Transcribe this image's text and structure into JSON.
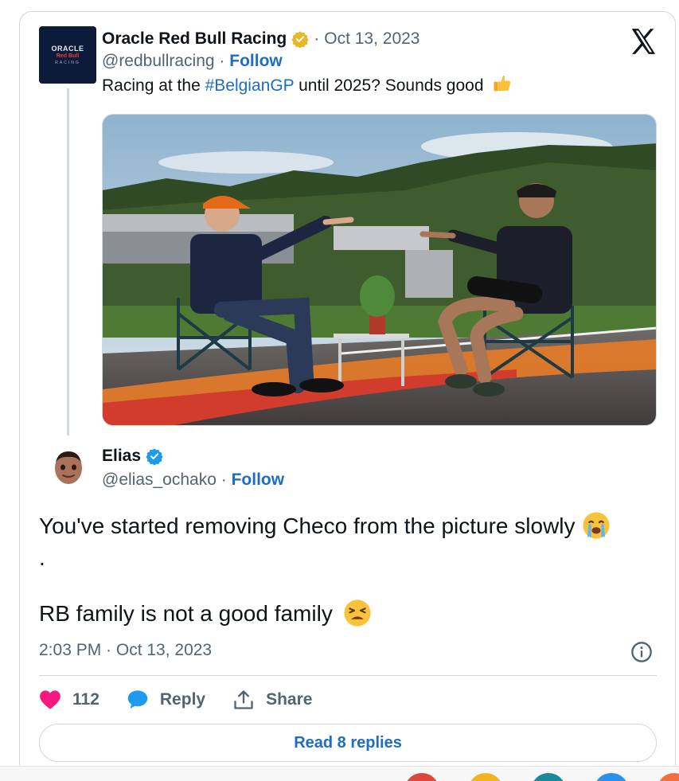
{
  "parent": {
    "avatar_lines": [
      "ORACLE",
      "Red Bull",
      "RACING"
    ],
    "name": "Oracle Red Bull Racing",
    "separator": "·",
    "date": "Oct 13, 2023",
    "handle": "@redbullracing",
    "follow_label": "Follow",
    "text_before": "Racing at the ",
    "hashtag": "#BelgianGP",
    "text_after": " until 2025? Sounds good",
    "badge_color": "#e8b829"
  },
  "reply": {
    "name": "Elias",
    "separator": "·",
    "handle": "@elias_ochako",
    "follow_label": "Follow",
    "line1": "You've started removing Checo from the picture slowly",
    "line_dot": ".",
    "line2": "RB family is not a good family",
    "timestamp": "2:03 PM · Oct 13, 2023",
    "badge_color": "#1d9bf0"
  },
  "actions": {
    "likes": "112",
    "reply_label": "Reply",
    "share_label": "Share"
  },
  "read_replies_label": "Read 8 replies",
  "colors": {
    "link": "#1d6ec2",
    "secondary": "#536471",
    "border": "#cfd9de",
    "like": "#f91880",
    "reply_bubble": "#1d9bf0"
  },
  "icons": [
    "x-logo-icon",
    "gold-verified-icon",
    "blue-verified-icon",
    "thumbs-up-icon",
    "crying-face-icon",
    "weary-face-icon",
    "info-icon",
    "heart-icon",
    "reply-bubble-icon",
    "share-icon"
  ]
}
